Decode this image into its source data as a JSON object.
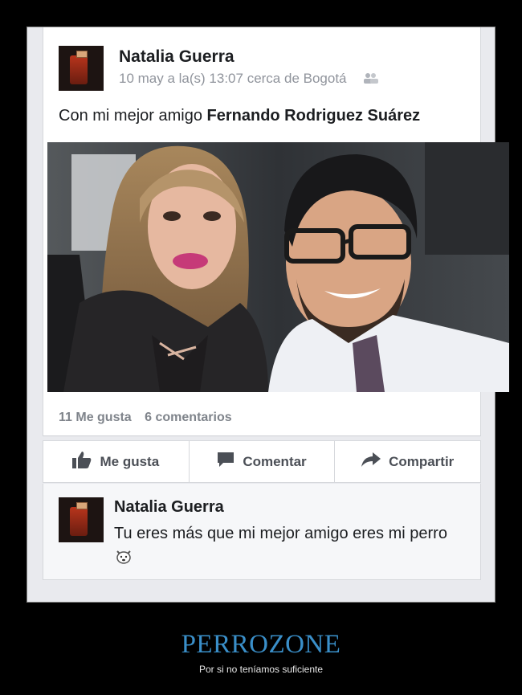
{
  "post": {
    "author": "Natalia Guerra",
    "timestamp": "10 may a la(s) 13:07 cerca de Bogotá",
    "privacy_icon": "friends-icon",
    "text_prefix": "Con mi mejor amigo ",
    "tagged_person": "Fernando Rodriguez Suárez",
    "photo_icon": "selfie-photo"
  },
  "counts": {
    "likes": "11 Me gusta",
    "comments": "6 comentarios"
  },
  "actions": {
    "like_label": "Me gusta",
    "comment_label": "Comentar",
    "share_label": "Compartir"
  },
  "comment": {
    "author": "Natalia Guerra",
    "text": "Tu eres más que mi mejor amigo eres mi perro",
    "emoji_icon": "dog-face-emoji"
  },
  "caption": {
    "title": "PERROZONE",
    "subtitle": "Por si no teníamos suficiente"
  }
}
